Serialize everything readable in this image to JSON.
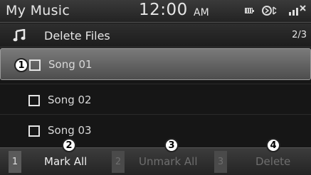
{
  "status_bar": {
    "title": "My Music",
    "time": "12:00",
    "ampm": "AM",
    "icons": [
      "battery-icon",
      "bluetooth-audio-icon",
      "signal-icon"
    ]
  },
  "header": {
    "icon": "music-note-icon",
    "title": "Delete Files",
    "page": "2/3"
  },
  "list": {
    "items": [
      {
        "label": "Song 01",
        "checked": false,
        "selected": true
      },
      {
        "label": "Song 02",
        "checked": false,
        "selected": false
      },
      {
        "label": "Song 03",
        "checked": false,
        "selected": false
      }
    ]
  },
  "buttons": [
    {
      "number": "1",
      "label": "Mark All",
      "enabled": true
    },
    {
      "number": "2",
      "label": "Unmark All",
      "enabled": false
    },
    {
      "number": "3",
      "label": "Delete",
      "enabled": false
    }
  ],
  "callouts": [
    "1",
    "2",
    "3",
    "4"
  ],
  "colors": {
    "screen_bg": "#161616",
    "selected_row": "#6a6a6a",
    "disabled_text": "#6e6e6e"
  }
}
